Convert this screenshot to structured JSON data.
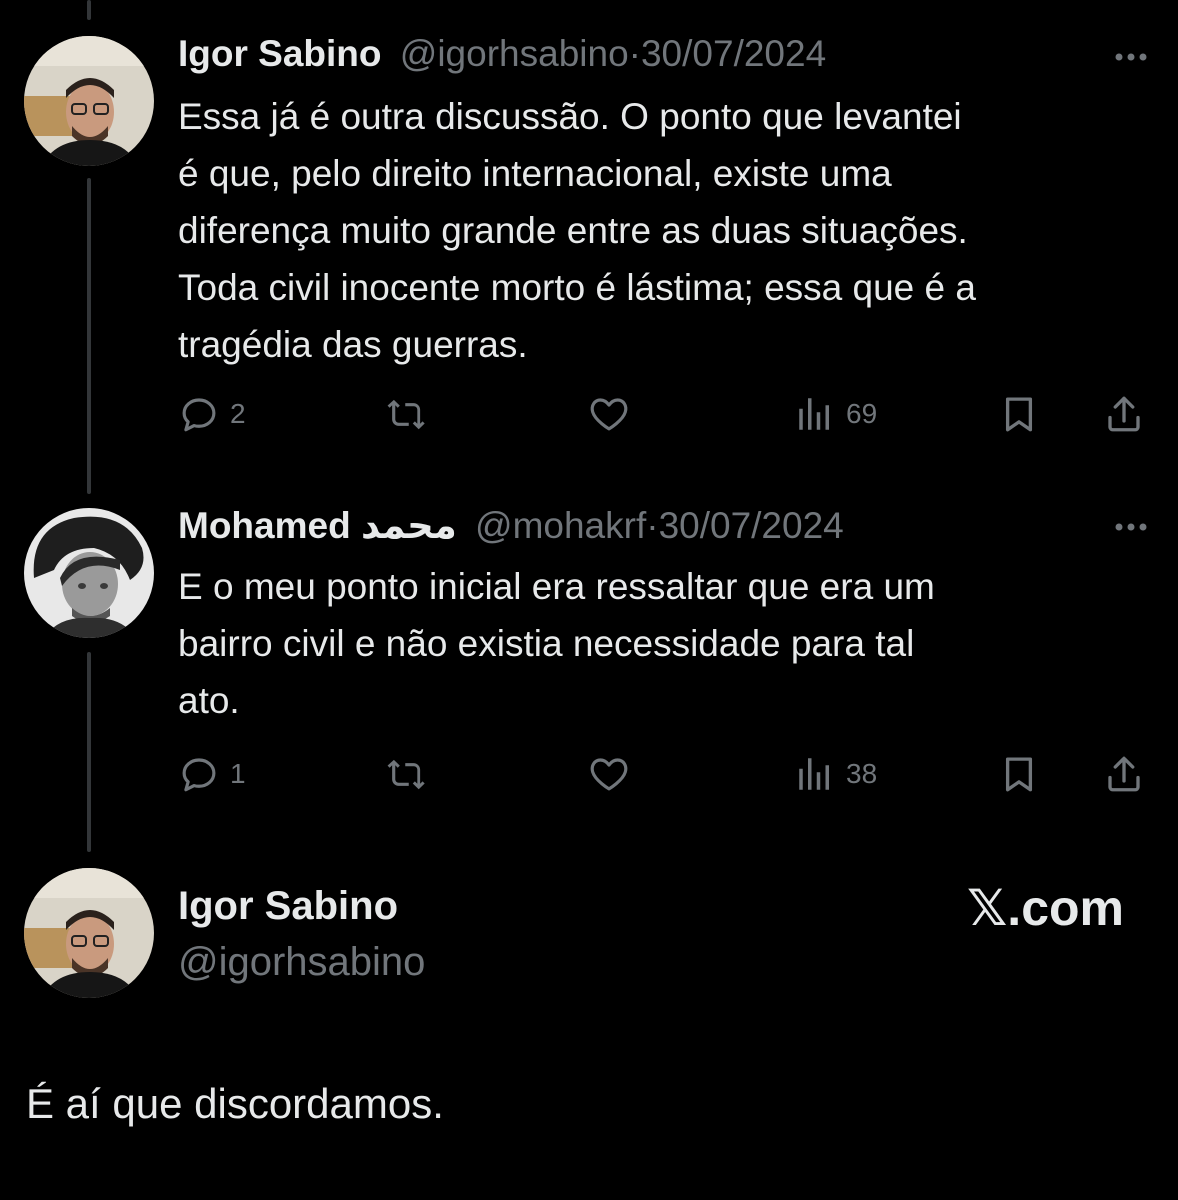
{
  "tweets": [
    {
      "name": "Igor Sabino",
      "handle": "@igorhsabino",
      "separator": "·",
      "date": "30/07/2024",
      "lines": [
        "Essa já é outra discussão. O ponto que levantei",
        "é que, pelo direito internacional, existe uma",
        "diferença muito grande entre as duas situações.",
        "Toda civil inocente morto é lástima; essa que é a",
        "tragédia das guerras."
      ],
      "replies": "2",
      "views": "69"
    },
    {
      "name": "Mohamed محمد",
      "handle": "@mohakrf",
      "separator": "·",
      "date": "30/07/2024",
      "lines": [
        "E o meu ponto inicial era ressaltar que era um",
        "bairro civil e não existia necessidade para tal",
        "ato."
      ],
      "replies": "1",
      "views": "38"
    }
  ],
  "main_post": {
    "name": "Igor Sabino",
    "handle": "@igorhsabino",
    "brand": "𝕏.com",
    "text": "É aí que discordamos."
  },
  "icons": {
    "reply": "reply-icon",
    "retweet": "retweet-icon",
    "like": "heart-icon",
    "views": "views-icon",
    "bookmark": "bookmark-icon",
    "share": "share-icon",
    "more": "more-icon"
  },
  "colors": {
    "background": "#000000",
    "text": "#e7e9ea",
    "muted": "#71767b",
    "thread_line": "#333639"
  }
}
